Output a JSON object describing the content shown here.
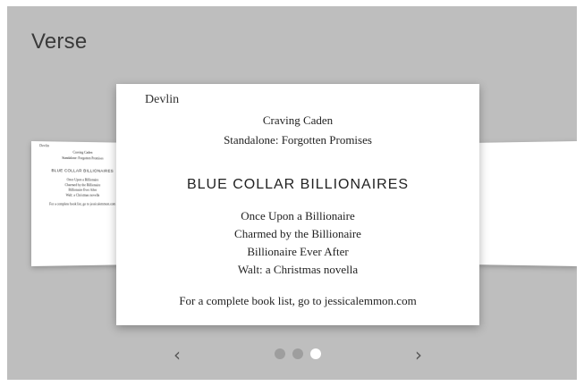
{
  "app": {
    "title": "Verse"
  },
  "page": {
    "author": "Devlin",
    "craving": "Craving Caden",
    "standalone": "Standalone: Forgotten Promises",
    "series": "BLUE COLLAR BILLIONAIRES",
    "books": [
      "Once Upon a Billionaire",
      "Charmed by the Billionaire",
      "Billionaire Ever After",
      "Walt: a Christmas novella"
    ],
    "footer": "For a complete book list, go to jessicalemmon.com"
  },
  "pagination": {
    "prev_icon": "‹",
    "next_icon": "›",
    "total_pages": 3,
    "active_index": 2
  },
  "colors": {
    "background": "#bebebe",
    "card": "#ffffff",
    "dot_inactive": "#9e9e9e",
    "dot_active": "#ffffff"
  }
}
